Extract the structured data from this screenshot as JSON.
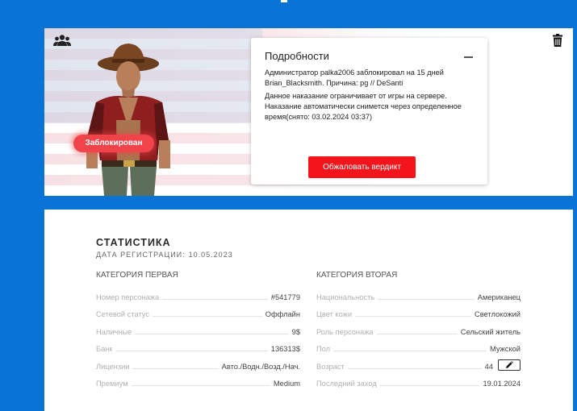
{
  "header": {
    "colors": {
      "background": "#0a73d6",
      "accent": "#f4141c",
      "badge": "#f0434a"
    }
  },
  "ban": {
    "status_label": "Заблокирован",
    "details": {
      "title": "Подробности",
      "line1": "Администратор palka2006 заблокировал на 15 дней Brian_Blacksmith. Причина: pg // DeSanti",
      "line2": "Данное наказание ограничивает от игры на сервере. Наказание автоматически снимется через определенное время(снято: 03.02.2024 03:37)",
      "appeal_button": "Обжаловать вердикт"
    },
    "icons": {
      "top_left": "group-icon",
      "top_right": "trash-icon",
      "collapse": "minus-icon"
    }
  },
  "stats": {
    "title": "СТАТИСТИКА",
    "reg_label": "ДАТА РЕГИСТРАЦИИ:",
    "reg_value": "10.05.2023",
    "category1": {
      "title": "КАТЕГОРИЯ ПЕРВАЯ",
      "rows": [
        {
          "label": "Номер персонажа",
          "value": "#541779"
        },
        {
          "label": "Сетевой статус",
          "value": "Оффлайн"
        },
        {
          "label": "Наличные",
          "value": "9$"
        },
        {
          "label": "Банк",
          "value": "136313$"
        },
        {
          "label": "Лицензии",
          "value": "Авто./Водн./Возд./Нач."
        },
        {
          "label": "Премиум",
          "value": "Medium"
        }
      ]
    },
    "category2": {
      "title": "КАТЕГОРИЯ ВТОРАЯ",
      "rows": [
        {
          "label": "Национальность",
          "value": "Американец"
        },
        {
          "label": "Цвет кожи",
          "value": "Светлокожий"
        },
        {
          "label": "Роль персонажа",
          "value": "Сельский житель"
        },
        {
          "label": "Пол",
          "value": "Мужской"
        },
        {
          "label": "Возраст",
          "value": "44",
          "icon": "pencil-icon"
        },
        {
          "label": "Последний заход",
          "value": "19.01.2024"
        }
      ]
    }
  }
}
